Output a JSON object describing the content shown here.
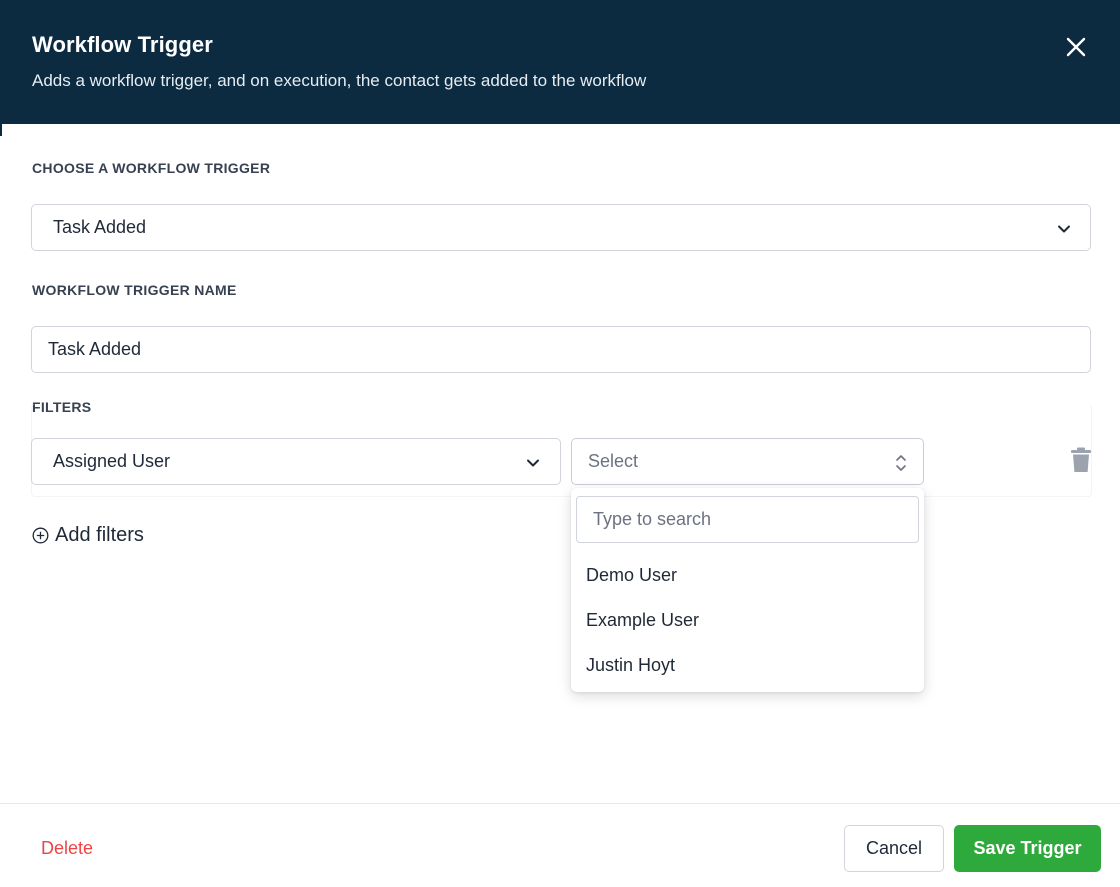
{
  "header": {
    "title": "Workflow Trigger",
    "subtitle": "Adds a workflow trigger, and on execution, the contact gets added to the workflow",
    "close_icon": "close-icon"
  },
  "trigger": {
    "label": "CHOOSE A WORKFLOW TRIGGER",
    "value": "Task Added"
  },
  "trigger_name": {
    "label": "WORKFLOW TRIGGER NAME",
    "value": "Task Added"
  },
  "filters": {
    "label": "FILTERS",
    "field_value": "Assigned User",
    "select_placeholder": "Select",
    "delete_icon": "trash-icon",
    "add_label": "Add filters"
  },
  "dropdown": {
    "search_placeholder": "Type to search",
    "options": [
      "Demo User",
      "Example User",
      "Justin Hoyt"
    ]
  },
  "footer": {
    "delete_label": "Delete",
    "cancel_label": "Cancel",
    "save_label": "Save Trigger"
  },
  "colors": {
    "header_bg": "#0c2a40",
    "primary_green": "#2eaa3c",
    "danger_red": "#ef4444"
  }
}
